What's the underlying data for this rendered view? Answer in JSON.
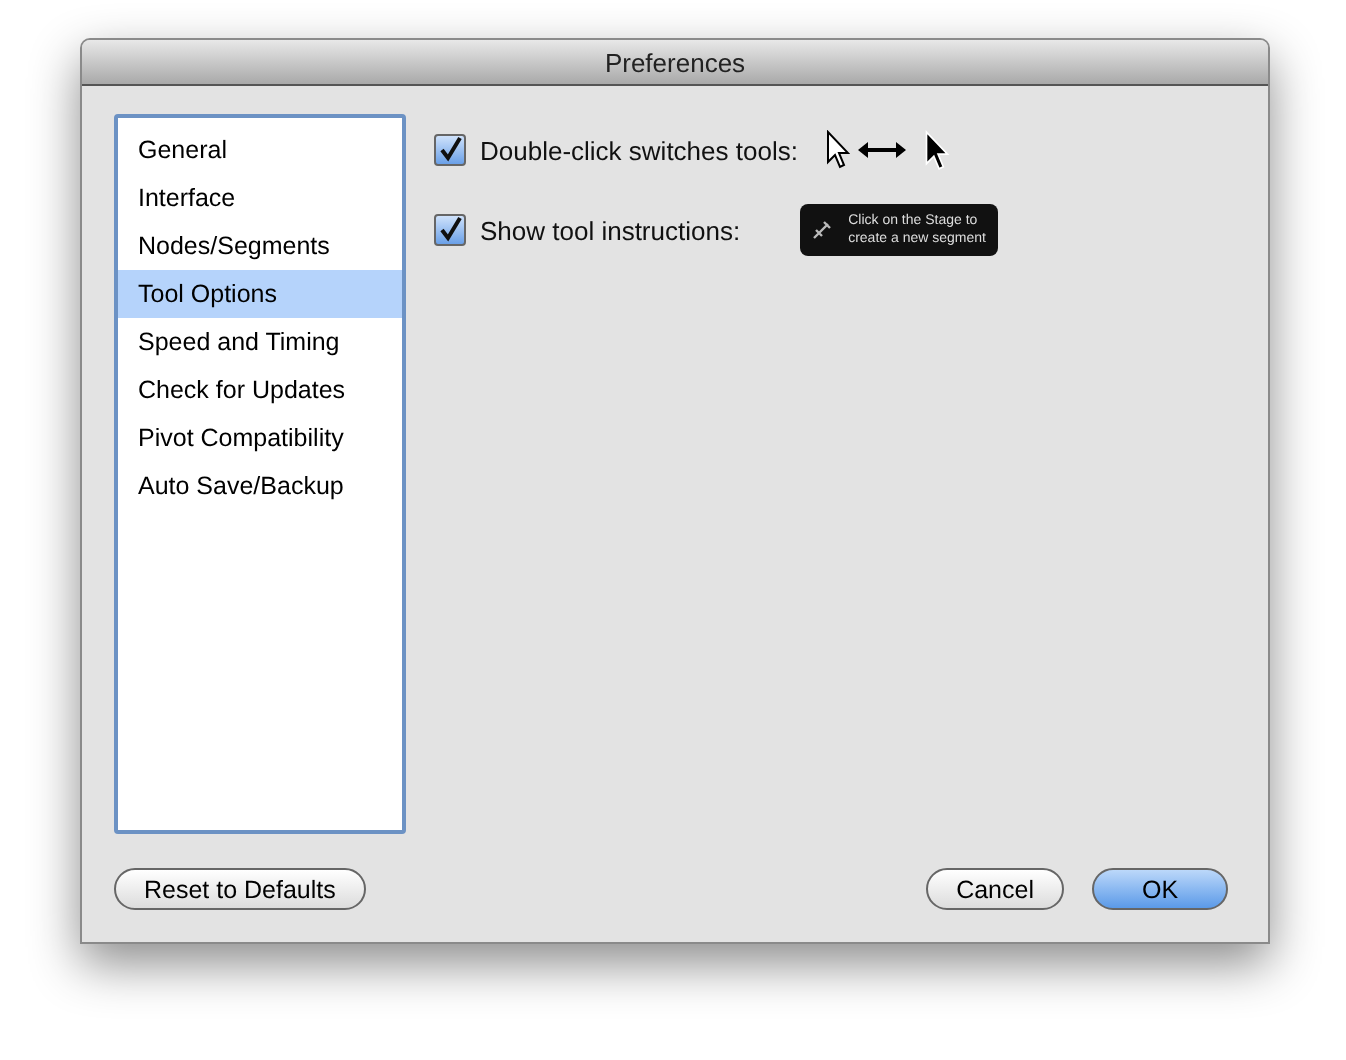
{
  "window": {
    "title": "Preferences"
  },
  "sidebar": {
    "items": [
      {
        "label": "General",
        "selected": false
      },
      {
        "label": "Interface",
        "selected": false
      },
      {
        "label": "Nodes/Segments",
        "selected": false
      },
      {
        "label": "Tool Options",
        "selected": true
      },
      {
        "label": "Speed and Timing",
        "selected": false
      },
      {
        "label": "Check for Updates",
        "selected": false
      },
      {
        "label": "Pivot Compatibility",
        "selected": false
      },
      {
        "label": "Auto Save/Backup",
        "selected": false
      }
    ]
  },
  "options": [
    {
      "label": "Double-click switches tools:",
      "checked": true,
      "kind": "cursors"
    },
    {
      "label": "Show tool instructions:",
      "checked": true,
      "kind": "tooltip",
      "tooltip_lines": [
        "Click on the Stage to",
        "create a new segment"
      ]
    }
  ],
  "reset_button": "Reset to Defaults",
  "buttons": [
    {
      "label": "Cancel",
      "default": false
    },
    {
      "label": "OK",
      "default": true
    }
  ]
}
